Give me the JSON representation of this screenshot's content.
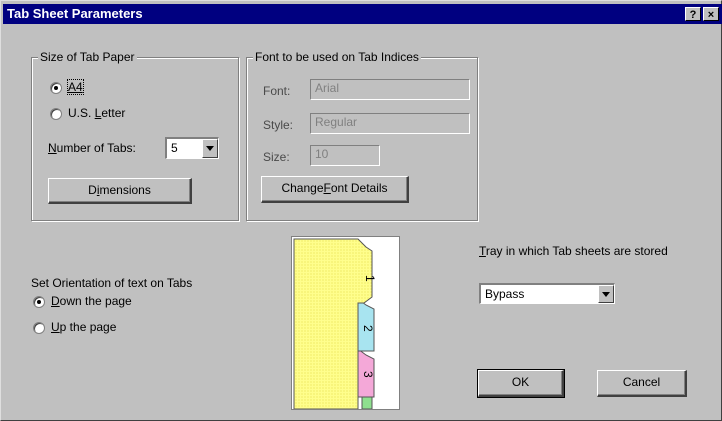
{
  "window": {
    "title": "Tab Sheet Parameters",
    "help_label": "?",
    "close_label": "×"
  },
  "paper_group": {
    "label": "Size of Tab Paper",
    "option_a4": "A4",
    "option_letter_pre": "U.S. ",
    "option_letter_u": "L",
    "option_letter_post": "etter",
    "number_of_tabs_label_u": "N",
    "number_of_tabs_label_rest": "umber of Tabs:",
    "number_of_tabs_value": "5",
    "dimensions_pre": "D",
    "dimensions_u": "i",
    "dimensions_post": "mensions"
  },
  "font_group": {
    "label": "Font to be used on Tab Indices",
    "font_label": "Font:",
    "font_value": "Arial",
    "style_label": "Style:",
    "style_value": "Regular",
    "size_label": "Size:",
    "size_value": "10",
    "change_pre": "Change ",
    "change_u": "F",
    "change_post": "ont Details"
  },
  "orientation": {
    "heading": "Set Orientation of text on Tabs",
    "down_u": "D",
    "down_rest": "own the page",
    "up_u": "U",
    "up_rest": "p the page",
    "selected": "down"
  },
  "preview": {
    "tab_numbers": [
      "1",
      "2",
      "3"
    ],
    "colors": {
      "sheet": "#fffe8c",
      "tab2": "#a8e4f0",
      "tab3": "#f4a8d8",
      "tab4": "#8ee08e"
    }
  },
  "tray": {
    "label_u": "T",
    "label_rest": "ray in which Tab sheets are stored",
    "value": "Bypass"
  },
  "buttons": {
    "ok": "OK",
    "cancel": "Cancel"
  }
}
